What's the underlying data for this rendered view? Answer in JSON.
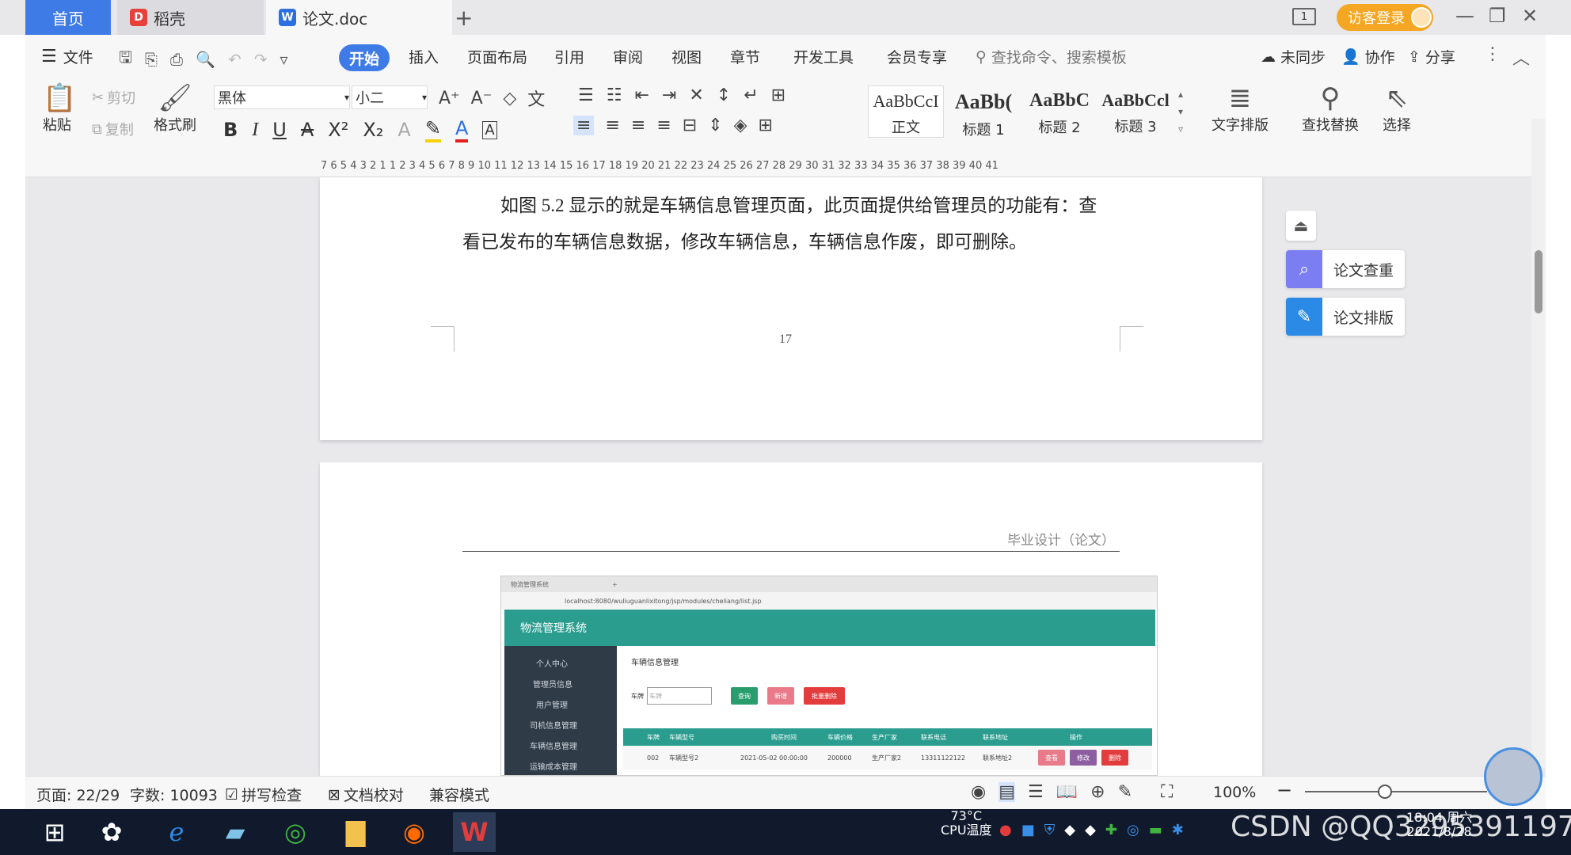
{
  "titlebar": {
    "tabs": [
      {
        "label": "首页"
      },
      {
        "label": "稻壳"
      },
      {
        "label": "论文.doc"
      }
    ],
    "new_tab": "+",
    "login": "访客登录",
    "page_indicator": "1"
  },
  "menu": {
    "file": "文件",
    "items": [
      "开始",
      "插入",
      "页面布局",
      "引用",
      "审阅",
      "视图",
      "章节",
      "开发工具",
      "会员专享"
    ],
    "search_placeholder": "查找命令、搜索模板",
    "sync": "未同步",
    "collab": "协作",
    "share": "分享"
  },
  "ribbon": {
    "paste": "粘贴",
    "cut": "剪切",
    "copy": "复制",
    "format_painter": "格式刷",
    "font_name": "黑体",
    "font_size": "小二",
    "styles": [
      {
        "preview": "AaBbCcI",
        "name": "正文"
      },
      {
        "preview": "AaBb(",
        "name": "标题 1"
      },
      {
        "preview": "AaBbC",
        "name": "标题 2"
      },
      {
        "preview": "AaBbCcl",
        "name": "标题 3"
      }
    ],
    "text_layout": "文字排版",
    "find_replace": "查找替换",
    "select": "选择"
  },
  "ruler": {
    "ticks": "7   6   5   4   3   2   1       1   2   3   4   5   6   7   8   9   10  11  12  13  14  15  16  17  18  19  20  21  22  23  24  25  26  27  28  29  30  31  32  33  34  35  36  37  38  39  40  41"
  },
  "document": {
    "para_line1": "如图 5.2 显示的就是车辆信息管理页面，此页面提供给管理员的功能有：查",
    "para_line2": "看已发布的车辆信息数据，修改车辆信息，车辆信息作废，即可删除。",
    "page_number": "17",
    "header_text": "毕业设计（论文）",
    "screenshot": {
      "tab_title": "物流管理系统",
      "url": "localhost:8080/wuliuguanlixitong/jsp/modules/cheliang/list.jsp",
      "app_title": "物流管理系统",
      "breadcrumb_title": "车辆信息管理",
      "side_menu": [
        "个人中心",
        "管理员信息",
        "用户管理",
        "司机信息管理",
        "车辆信息管理",
        "运输成本管理"
      ],
      "search_label": "车牌",
      "search_placeholder": "车牌",
      "btn_query": "查询",
      "btn_add": "新增",
      "btn_batch_delete": "批量删除",
      "columns": [
        "车牌",
        "车辆型号",
        "购买时间",
        "车辆价格",
        "生产厂家",
        "联系电话",
        "联系地址",
        "操作"
      ],
      "row": [
        "002",
        "车辆型号2",
        "2021-05-02 00:00:00",
        "200000",
        "生产厂家2",
        "13311122122",
        "联系地址2"
      ],
      "row_btns": [
        "查看",
        "修改",
        "删除"
      ]
    }
  },
  "side_panel": {
    "check": "论文查重",
    "layout": "论文排版"
  },
  "status": {
    "page": "页面: 22/29",
    "words": "字数: 10093",
    "spell": "拼写检查",
    "proof": "文档校对",
    "compat": "兼容模式",
    "zoom": "100%"
  },
  "taskbar": {
    "temp": "73°C",
    "cpu": "CPU温度",
    "time": "18:04 周六",
    "date": "2021/8/28",
    "watermark": "CSDN @QQ3295391197"
  }
}
